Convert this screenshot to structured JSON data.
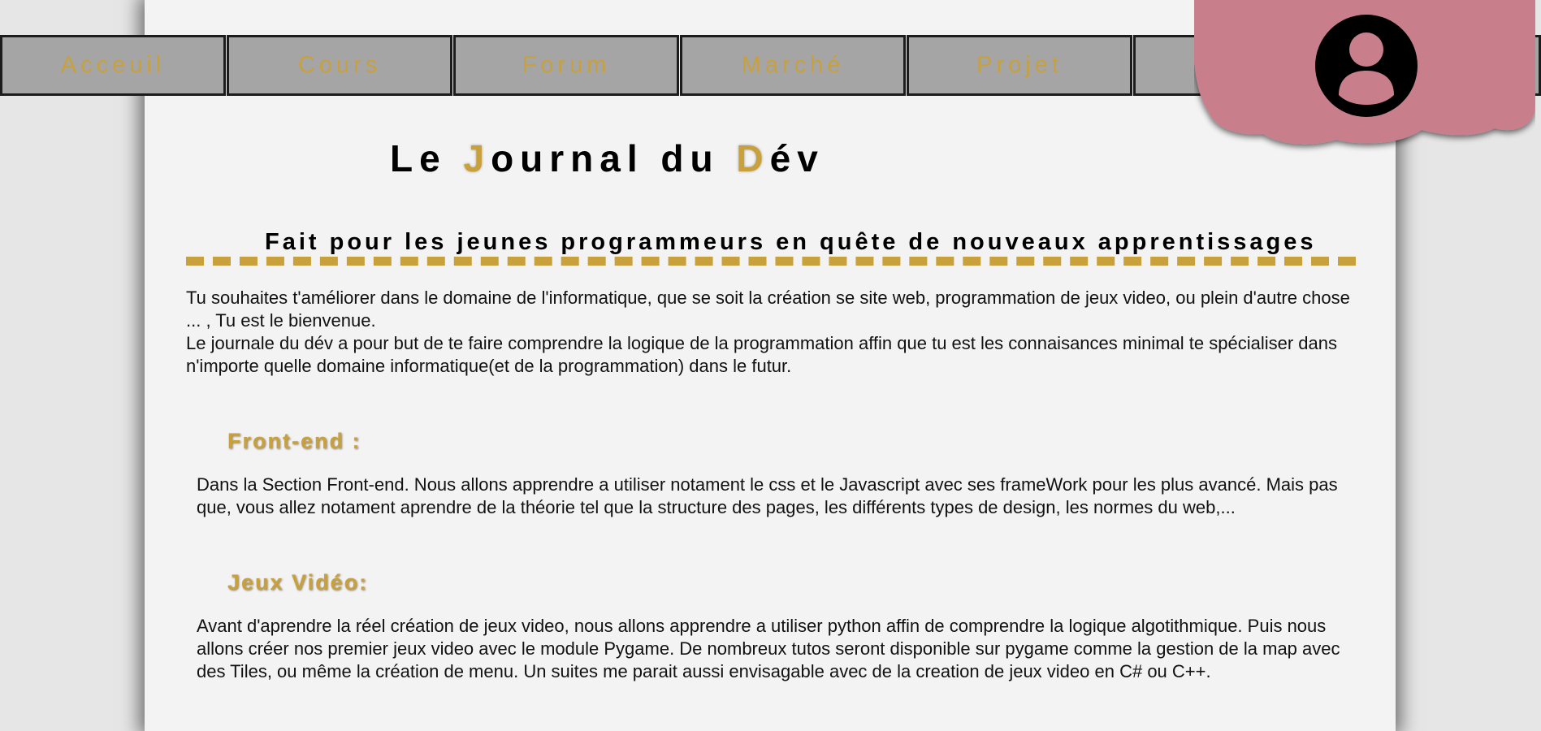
{
  "nav": {
    "items": [
      {
        "label": "Acceuil"
      },
      {
        "label": "Cours"
      },
      {
        "label": "Forum"
      },
      {
        "label": "Marché"
      },
      {
        "label": "Projet"
      },
      {
        "label": ""
      }
    ]
  },
  "profile": {
    "icon": "account-circle-icon",
    "blob_color": "#c87f8b"
  },
  "colors": {
    "accent": "#c8a03c",
    "nav_bg": "#a5a5a5",
    "page_bg": "#f3f3f3"
  },
  "header": {
    "title_part1": "Le ",
    "title_accent1": "J",
    "title_part2": "ournal du ",
    "title_accent2": "D",
    "title_part3": "év",
    "tagline": "Fait pour les jeunes programmeurs en quête de nouveaux apprentissages"
  },
  "intro": {
    "paragraph1": "Tu souhaites t'améliorer dans le domaine de l'informatique, que se soit la création se site web, programmation de jeux video, ou plein d'autre chose ... , Tu est le bienvenue.",
    "paragraph2": "Le journale du dév a pour but de te faire comprendre la logique de la programmation affin que tu est les connaisances minimal te spécialiser dans n'importe quelle domaine informatique(et de la programmation) dans le futur."
  },
  "sections": [
    {
      "title": "Front-end :",
      "body": "Dans la Section Front-end. Nous allons apprendre a utiliser notament le css et le Javascript avec ses frameWork pour les plus avancé. Mais pas que, vous allez notament aprendre de la théorie tel que la structure des pages, les différents types de design, les normes du web,..."
    },
    {
      "title": "Jeux Vidéo:",
      "body": "Avant d'aprendre la réel création de jeux video, nous allons apprendre a utiliser python affin de comprendre la logique algotithmique. Puis nous allons créer nos premier jeux video avec le module Pygame. De nombreux tutos seront disponible sur pygame comme la gestion de la map avec des Tiles, ou même la création de menu. Un suites me parait aussi envisagable avec de la creation de jeux video en C# ou C++."
    }
  ]
}
